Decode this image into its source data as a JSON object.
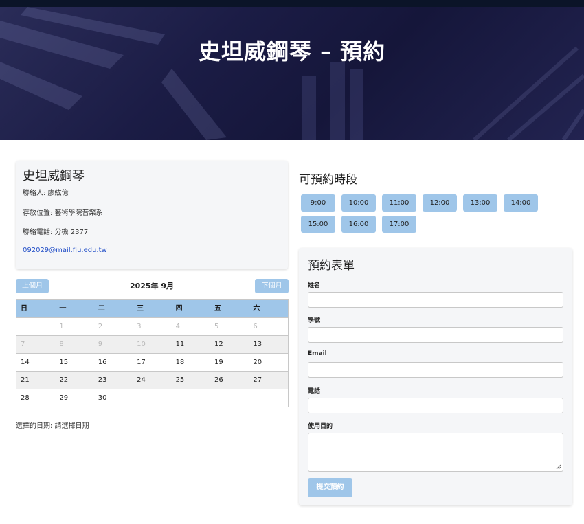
{
  "hero": {
    "title": "史坦威鋼琴 – 預約"
  },
  "info": {
    "name": "史坦威鋼琴",
    "contact": "聯絡人: 廖紘億",
    "location": "存放位置: 藝術學院音樂系",
    "phone": "聯絡電話: 分機 2377",
    "email": "092029@mail.fju.edu.tw"
  },
  "calendar": {
    "prev_label": "上個月",
    "next_label": "下個月",
    "month_label": "2025年 9月",
    "weekdays": [
      "日",
      "一",
      "二",
      "三",
      "四",
      "五",
      "六"
    ],
    "weeks": [
      [
        "",
        "1",
        "2",
        "3",
        "4",
        "5",
        "6"
      ],
      [
        "7",
        "8",
        "9",
        "10",
        "11",
        "12",
        "13"
      ],
      [
        "14",
        "15",
        "16",
        "17",
        "18",
        "19",
        "20"
      ],
      [
        "21",
        "22",
        "23",
        "24",
        "25",
        "26",
        "27"
      ],
      [
        "28",
        "29",
        "30",
        "",
        "",
        "",
        ""
      ]
    ],
    "past_days": [
      "1",
      "2",
      "3",
      "4",
      "5",
      "6",
      "7",
      "8",
      "9",
      "10"
    ],
    "selected_text": "選擇的日期: 請選擇日期"
  },
  "slots": {
    "title": "可預約時段",
    "times": [
      "9:00",
      "10:00",
      "11:00",
      "12:00",
      "13:00",
      "14:00",
      "15:00",
      "16:00",
      "17:00"
    ]
  },
  "form": {
    "title": "預約表單",
    "name_label": "姓名",
    "student_id_label": "學號",
    "email_label": "Email",
    "phone_label": "電話",
    "purpose_label": "使用目的",
    "submit_label": "提交預約"
  },
  "colors": {
    "accent": "#9fc6e9",
    "hero_dark": "#1b1c45",
    "card_bg": "#f5f6f8",
    "link": "#2450c8"
  }
}
